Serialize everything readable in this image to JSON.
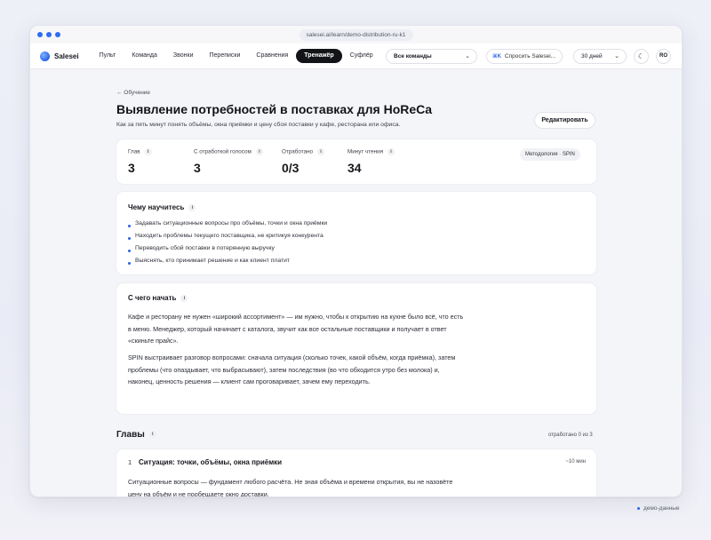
{
  "browser": {
    "url": "salesei.ai/learn/demo-distribution-ru-k1"
  },
  "nav": {
    "brand": "Salesei",
    "tabs": [
      "Пульт",
      "Команда",
      "Звонки",
      "Переписки",
      "Сравнения",
      "Тренажёр",
      "Суфлёр"
    ],
    "active_tab": "Тренажёр",
    "team_select": "Все команды",
    "ask_shortcut": "⌘K",
    "ask_label": "Спросить Salesei...",
    "period": "30 дней",
    "theme_icon": "☾",
    "avatar": "RO"
  },
  "page": {
    "back": "← Обучение",
    "title": "Выявление потребностей в поставках для HoReCa",
    "subtitle": "Как за пять минут понять объёмы, окна приёмки и цену сбоя поставки у кафе, ресторана или офиса.",
    "edit_button": "Редактировать"
  },
  "stats": {
    "items": [
      {
        "label": "Глав",
        "value": "3"
      },
      {
        "label": "С отработкой голосом",
        "value": "3"
      },
      {
        "label": "Отработано",
        "value": "0/3"
      },
      {
        "label": "Минут чтения",
        "value": "34"
      }
    ],
    "methodology": "Методология · SPIN"
  },
  "learn": {
    "title": "Чему научитесь",
    "items": [
      "Задавать ситуационные вопросы про объёмы, точки и окна приёмки",
      "Находить проблемы текущего поставщика, не критикуя конкурента",
      "Переводить сбой поставки в потерянную выручку",
      "Выяснять, кто принимает решение и как клиент платит"
    ]
  },
  "start": {
    "title": "С чего начать",
    "paragraphs": [
      "Кафе и ресторану не нужен «широкий ассортимент» — им нужно, чтобы к открытию на кухне было всё, что есть в меню. Менеджер, который начинает с каталога, звучит как все остальные поставщики и получает в ответ «скиньте прайс».",
      "SPIN выстраивает разговор вопросами: сначала ситуация (сколько точек, какой объём, когда приёмка), затем проблемы (что опаздывает, что выбрасывают), затем последствия (во что обходится утро без молока) и, наконец, ценность решения — клиент сам проговаривает, зачем ему переходить."
    ]
  },
  "chapters": {
    "title": "Главы",
    "progress": "отработано 0 из 3",
    "items": [
      {
        "number": "1",
        "title": "Ситуация: точки, объёмы, окна приёмки",
        "duration": "~10 мин",
        "text": "Ситуационные вопросы — фундамент любого расчёта. Не зная объёма и времени открытия, вы не назовёте цену на объём и не пообещаете окно доставки."
      }
    ]
  },
  "footer": {
    "demo": "демо-данные"
  },
  "colors": {
    "accent": "#2a62e8",
    "active_tab_bg": "#131417"
  }
}
